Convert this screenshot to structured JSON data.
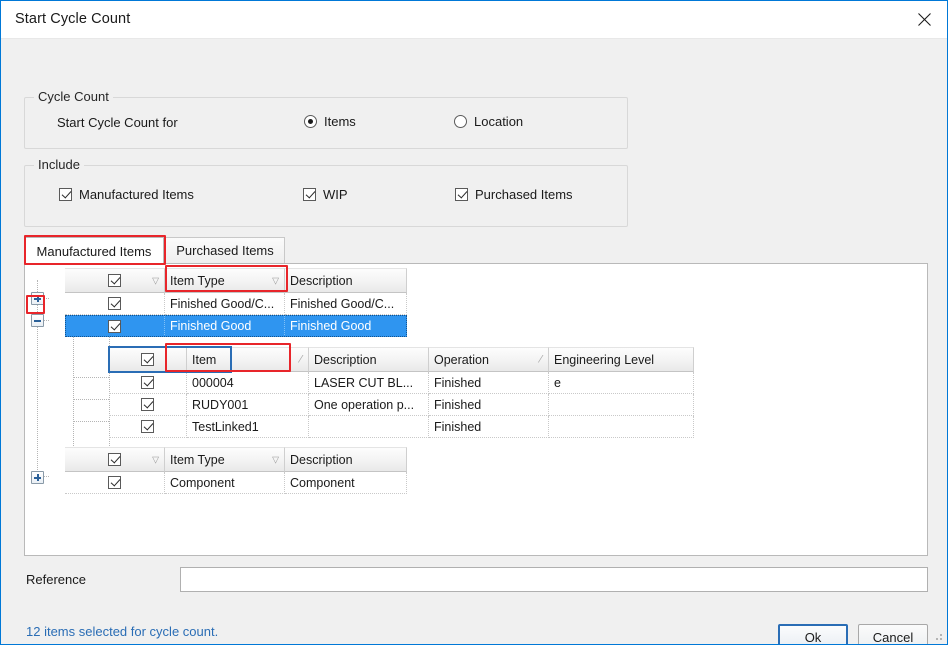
{
  "window": {
    "title": "Start Cycle Count",
    "close_icon": "close-icon"
  },
  "cycle_count_group": {
    "legend": "Cycle Count",
    "field_label": "Start Cycle Count for",
    "options": [
      {
        "label": "Items",
        "selected": true
      },
      {
        "label": "Location",
        "selected": false
      }
    ]
  },
  "include_group": {
    "legend": "Include",
    "checkboxes": [
      {
        "label": "Manufactured Items",
        "checked": true
      },
      {
        "label": "WIP",
        "checked": true
      },
      {
        "label": "Purchased Items",
        "checked": true
      }
    ]
  },
  "tabs": [
    {
      "label": "Manufactured Items",
      "active": true
    },
    {
      "label": "Purchased Items",
      "active": false
    }
  ],
  "outer_grid_top": {
    "headers": {
      "checkbox": "",
      "item_type": "Item Type",
      "description": "Description"
    },
    "rows": [
      {
        "checked": true,
        "item_type": "Finished Good/C...",
        "description": "Finished Good/C...",
        "expander": "plus",
        "selected": false
      },
      {
        "checked": true,
        "item_type": "Finished Good",
        "description": "Finished Good",
        "expander": "minus",
        "selected": true
      }
    ]
  },
  "inner_grid": {
    "headers": {
      "checkbox": "",
      "item": "Item",
      "description": "Description",
      "operation": "Operation",
      "engineering_level": "Engineering Level"
    },
    "rows": [
      {
        "checked": true,
        "item": "000004",
        "description": "LASER CUT BL...",
        "operation": "Finished",
        "engineering_level": "e"
      },
      {
        "checked": true,
        "item": "RUDY001",
        "description": "One operation p...",
        "operation": "Finished",
        "engineering_level": ""
      },
      {
        "checked": true,
        "item": "TestLinked1",
        "description": "",
        "operation": "Finished",
        "engineering_level": ""
      }
    ]
  },
  "outer_grid_bottom": {
    "headers": {
      "checkbox": "",
      "item_type": "Item Type",
      "description": "Description"
    },
    "rows": [
      {
        "checked": true,
        "item_type": "Component",
        "description": "Component",
        "expander": "plus",
        "selected": false
      }
    ]
  },
  "reference": {
    "label": "Reference",
    "value": "",
    "placeholder": ""
  },
  "status": {
    "text": "12 items selected for cycle count."
  },
  "buttons": {
    "ok": "Ok",
    "cancel": "Cancel"
  },
  "glyphs": {
    "filter": "▽",
    "sort_asc": "⁄"
  },
  "colors": {
    "accent": "#0078d7",
    "selection": "#2f95f0",
    "annotation": "#e8252a",
    "focus": "#2a6db5",
    "status_text": "#2a6db5",
    "dialog_bg": "#f0f0f0"
  }
}
